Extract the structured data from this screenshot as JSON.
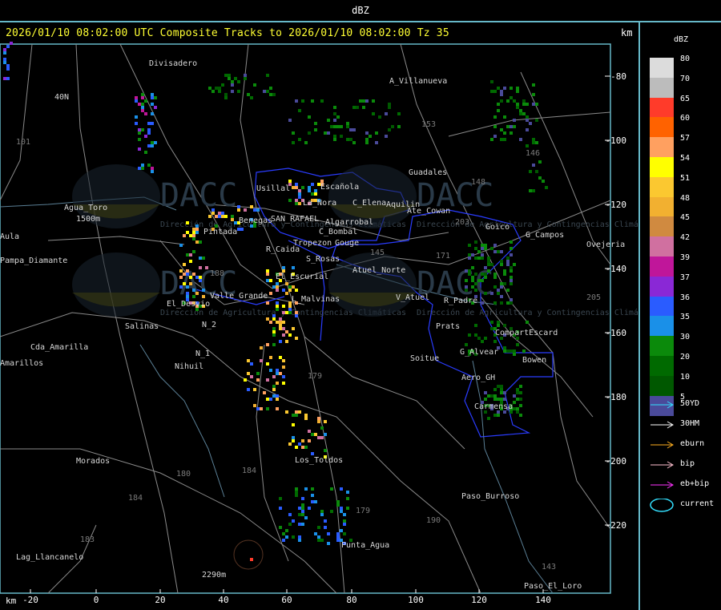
{
  "header": {
    "product": "dBZ"
  },
  "title": "2026/01/10 08:02:00 UTC Composite Tracks to 2026/01/10 08:02:00 Tz 35",
  "axis": {
    "unit": "km",
    "x_ticks": [
      "-20",
      "0",
      "20",
      "40",
      "60",
      "80",
      "100",
      "120",
      "140"
    ],
    "y_ticks": [
      "-80",
      "-100",
      "-120",
      "-140",
      "-160",
      "-180",
      "-200",
      "-220"
    ]
  },
  "legend": {
    "title": "dBZ",
    "scale": [
      {
        "value": "80",
        "color": "#dcdcdc"
      },
      {
        "value": "70",
        "color": "#bcbcbc"
      },
      {
        "value": "65",
        "color": "#ff3b2a"
      },
      {
        "value": "60",
        "color": "#ff6200"
      },
      {
        "value": "57",
        "color": "#ffa060"
      },
      {
        "value": "54",
        "color": "#ffff00"
      },
      {
        "value": "51",
        "color": "#fbc830"
      },
      {
        "value": "48",
        "color": "#f2b030"
      },
      {
        "value": "45",
        "color": "#d08a40"
      },
      {
        "value": "42",
        "color": "#d070a0"
      },
      {
        "value": "39",
        "color": "#c0169a"
      },
      {
        "value": "37",
        "color": "#8a28d6"
      },
      {
        "value": "36",
        "color": "#2a5cff"
      },
      {
        "value": "35",
        "color": "#1a90e8"
      },
      {
        "value": "30",
        "color": "#0b8a0b"
      },
      {
        "value": "20",
        "color": "#006a00"
      },
      {
        "value": "10",
        "color": "#005800"
      },
      {
        "value": "5",
        "color": "#4a4a9a"
      }
    ],
    "tracks": [
      {
        "label": "50YD",
        "color": "#33e0ff"
      },
      {
        "label": "30HM",
        "color": "#ffffff"
      },
      {
        "label": "eburn",
        "color": "#ffb020"
      },
      {
        "label": "bip",
        "color": "#ffc0d0"
      },
      {
        "label": "eb+bip",
        "color": "#ff33ff"
      },
      {
        "label": "current",
        "color": "#33e0ff"
      }
    ]
  },
  "map": {
    "places": [
      {
        "name": "Divisadero"
      },
      {
        "name": "A_Villanueva"
      },
      {
        "name": "40N"
      },
      {
        "name": "Guadales"
      },
      {
        "name": "Agua_Toro"
      },
      {
        "name": "1500m"
      },
      {
        "name": "La_Nora"
      },
      {
        "name": "C_Elena"
      },
      {
        "name": "Usillal"
      },
      {
        "name": "Escañola"
      },
      {
        "name": "Aquilin"
      },
      {
        "name": "Ate_Cowan"
      },
      {
        "name": "SAN_RAFAEL"
      },
      {
        "name": "Algarrobal"
      },
      {
        "name": "C_Bombal"
      },
      {
        "name": "Goico"
      },
      {
        "name": "G_Campos"
      },
      {
        "name": "Pintada"
      },
      {
        "name": "Benegas"
      },
      {
        "name": "Tropezon"
      },
      {
        "name": "Gouge"
      },
      {
        "name": "Pampa_Diamante"
      },
      {
        "name": "R_Caida"
      },
      {
        "name": "S_Rosas"
      },
      {
        "name": "Atuel_Norte"
      },
      {
        "name": "El_Escurial"
      },
      {
        "name": "El_Desvio"
      },
      {
        "name": "Valle_Grande"
      },
      {
        "name": "L_Malvinas"
      },
      {
        "name": "V_Atuel"
      },
      {
        "name": "R_Padre"
      },
      {
        "name": "Salinas"
      },
      {
        "name": "N_2"
      },
      {
        "name": "Prats"
      },
      {
        "name": "CompartEscard"
      },
      {
        "name": "Cda_Amarilla"
      },
      {
        "name": "N_1"
      },
      {
        "name": "Nihuil"
      },
      {
        "name": "Soitue"
      },
      {
        "name": "G_Alvear"
      },
      {
        "name": "Bowen"
      },
      {
        "name": "Aero_GH"
      },
      {
        "name": "Carmensa"
      },
      {
        "name": "Morados"
      },
      {
        "name": "Los_Toldos"
      },
      {
        "name": "Paso_Burroso"
      },
      {
        "name": "Punta_Agua"
      },
      {
        "name": "Lag_Llancanelo"
      },
      {
        "name": "2290m"
      },
      {
        "name": "Paso_El_Loro"
      },
      {
        "name": "Ovejeria"
      },
      {
        "name": "Amarillos"
      },
      {
        "name": "Aula"
      }
    ],
    "route_labels": [
      "101",
      "153",
      "146",
      "148",
      "203",
      "171",
      "143",
      "145",
      "179",
      "180",
      "184",
      "183",
      "190",
      "184",
      "179",
      "188",
      "205"
    ],
    "watermark": "DACC",
    "watermark_sub": "Dirección de Agricultura y Contingencias Climáticas"
  }
}
